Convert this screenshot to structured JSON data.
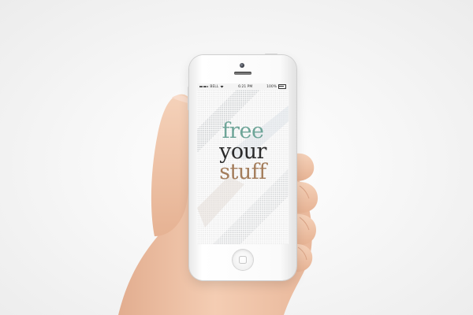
{
  "status_bar": {
    "carrier": "BELL",
    "time": "6:21 PM",
    "battery": "100%"
  },
  "logo": {
    "line1": "free",
    "line2": "your",
    "line3": "stuff"
  },
  "colors": {
    "logo_line1": "#6ea598",
    "logo_line2": "#2a2a2a",
    "logo_line3": "#a37c5a",
    "background": "#f2f2f2",
    "skin": "#f0c6aa"
  },
  "icons": {
    "signal": "signal-dots-icon",
    "wifi": "wifi-icon",
    "battery": "battery-icon",
    "home": "home-button-icon"
  }
}
